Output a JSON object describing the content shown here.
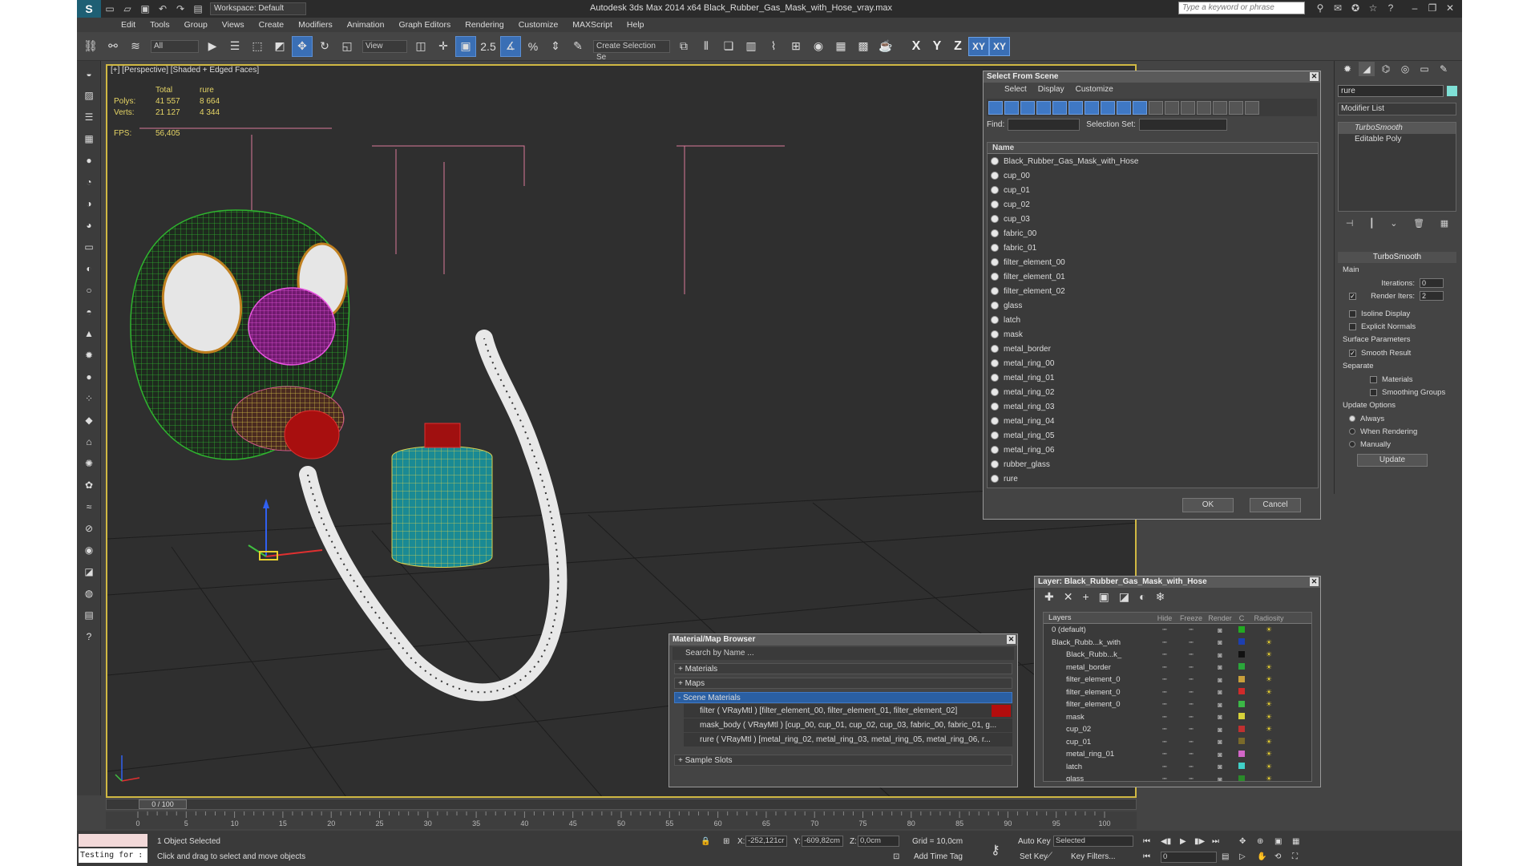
{
  "titlebar": {
    "workspace": "Workspace: Default",
    "title": "Autodesk 3ds Max  2014 x64     Black_Rubber_Gas_Mask_with_Hose_vray.max",
    "search_placeholder": "Type a keyword or phrase"
  },
  "menu": [
    "Edit",
    "Tools",
    "Group",
    "Views",
    "Create",
    "Modifiers",
    "Animation",
    "Graph Editors",
    "Rendering",
    "Customize",
    "MAXScript",
    "Help"
  ],
  "toolbar": {
    "selection_filter": "All",
    "ref_coord": "View",
    "named_selection": "Create Selection Se",
    "snap_label": "2.5",
    "axis_x": "X",
    "axis_y": "Y",
    "axis_z": "Z",
    "axis_xy": "XY",
    "axis_xy2": "XY"
  },
  "viewport": {
    "label": "[+] [Perspective] [Shaded + Edged Faces]",
    "stats": {
      "col_total": "Total",
      "col_sel": "rure",
      "polys_label": "Polys:",
      "polys_total": "41 557",
      "polys_sel": "8 664",
      "verts_label": "Verts:",
      "verts_total": "21 127",
      "verts_sel": "4 344",
      "fps_label": "FPS:",
      "fps": "56,405"
    }
  },
  "select_from_scene": {
    "title": "Select From Scene",
    "menu": [
      "Select",
      "Display",
      "Customize"
    ],
    "find_label": "Find:",
    "selection_set_label": "Selection Set:",
    "column": "Name",
    "objects": [
      "Black_Rubber_Gas_Mask_with_Hose",
      "cup_00",
      "cup_01",
      "cup_02",
      "cup_03",
      "fabric_00",
      "fabric_01",
      "filter_element_00",
      "filter_element_01",
      "filter_element_02",
      "glass",
      "latch",
      "mask",
      "metal_border",
      "metal_ring_00",
      "metal_ring_01",
      "metal_ring_02",
      "metal_ring_03",
      "metal_ring_04",
      "metal_ring_05",
      "metal_ring_06",
      "rubber_glass",
      "rure"
    ],
    "ok": "OK",
    "cancel": "Cancel"
  },
  "command_panel": {
    "object_name": "rure",
    "object_color": "#7fe0d6",
    "modifier_list": "Modifier List",
    "stack": [
      "TurboSmooth",
      "Editable Poly"
    ],
    "rollout_title": "TurboSmooth",
    "main_label": "Main",
    "iterations_label": "Iterations:",
    "iterations": "0",
    "render_iters_label": "Render Iters:",
    "render_iters": "2",
    "isoline": "Isoline Display",
    "explicit_normals": "Explicit Normals",
    "surface_params": "Surface Parameters",
    "smooth_result": "Smooth Result",
    "separate": "Separate",
    "materials": "Materials",
    "smoothing_groups": "Smoothing Groups",
    "update_options": "Update Options",
    "always": "Always",
    "when_rendering": "When Rendering",
    "manually": "Manually",
    "update": "Update"
  },
  "material_browser": {
    "title": "Material/Map Browser",
    "search": "Search by Name ...",
    "sec_materials": "+ Materials",
    "sec_maps": "+ Maps",
    "sec_scene": "- Scene Materials",
    "materials": [
      "filter  ( VRayMtl )  [filter_element_00, filter_element_01, filter_element_02]",
      "mask_body  ( VRayMtl )  [cup_00, cup_01, cup_02, cup_03, fabric_00, fabric_01, g...",
      "rure  ( VRayMtl )  [metal_ring_02, metal_ring_03, metal_ring_05, metal_ring_06, r..."
    ],
    "sec_sample": "+ Sample Slots"
  },
  "layer_manager": {
    "title": "Layer: Black_Rubber_Gas_Mask_with_Hose",
    "columns": [
      "Layers",
      "Hide",
      "Freeze",
      "Render",
      "C",
      "Radiosity"
    ],
    "rows": [
      {
        "name": "0 (default)",
        "color": "#22aa22"
      },
      {
        "name": "Black_Rubb...k_with",
        "color": "#1d3fb0"
      },
      {
        "name": "Black_Rubb...k_",
        "color": "#111111"
      },
      {
        "name": "metal_border",
        "color": "#2aa63a"
      },
      {
        "name": "filter_element_0",
        "color": "#c8a03c"
      },
      {
        "name": "filter_element_0",
        "color": "#d02a2a"
      },
      {
        "name": "filter_element_0",
        "color": "#3bb846"
      },
      {
        "name": "mask",
        "color": "#d6d13a"
      },
      {
        "name": "cup_02",
        "color": "#c03030"
      },
      {
        "name": "cup_01",
        "color": "#7a6a2a"
      },
      {
        "name": "metal_ring_01",
        "color": "#d266c8"
      },
      {
        "name": "latch",
        "color": "#40d0c8"
      },
      {
        "name": "glass",
        "color": "#2a8a2a"
      }
    ]
  },
  "timeline": {
    "frame": "0 / 100",
    "ticks": [
      "0",
      "5",
      "10",
      "15",
      "20",
      "25",
      "30",
      "35",
      "40",
      "45",
      "50",
      "55",
      "60",
      "65",
      "70",
      "75",
      "80",
      "85",
      "90",
      "95",
      "100"
    ]
  },
  "status": {
    "maxscript": "",
    "maxscript_prompt": "Testing for :",
    "selected": "1 Object Selected",
    "prompt": "Click and drag to select and move objects",
    "x_label": "X:",
    "x": "-252,121cr",
    "y_label": "Y:",
    "y": "-609,82cm",
    "z_label": "Z:",
    "z": "0,0cm",
    "grid": "Grid = 10,0cm",
    "add_time_tag": "Add Time Tag",
    "auto_key": "Auto Key",
    "set_key": "Set Key",
    "key_mode": "Selected",
    "key_filters": "Key Filters...",
    "frame_field": "0"
  }
}
